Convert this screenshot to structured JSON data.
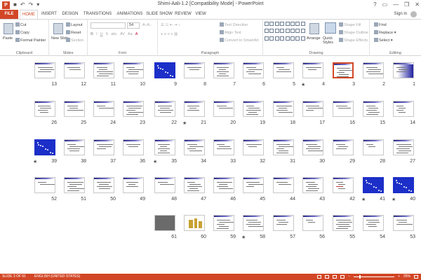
{
  "window": {
    "title": "Shimi-Aali-1.2 [Compatibility Mode] - PowerPoint",
    "app_icon": "P",
    "controls": [
      "?",
      "▭",
      "—",
      "❐",
      "✕"
    ],
    "qat": [
      "↶",
      "↷",
      "▾"
    ]
  },
  "tabs": [
    {
      "label": "FILE"
    },
    {
      "label": "HOME"
    },
    {
      "label": "INSERT"
    },
    {
      "label": "DESIGN"
    },
    {
      "label": "TRANSITIONS"
    },
    {
      "label": "ANIMATIONS"
    },
    {
      "label": "SLIDE SHOW"
    },
    {
      "label": "REVIEW"
    },
    {
      "label": "VIEW"
    }
  ],
  "signin": "Sign in",
  "ribbon": {
    "clipboard": {
      "label": "Clipboard",
      "paste": "Paste",
      "cut": "Cut",
      "copy": "Copy",
      "format_painter": "Format Painter"
    },
    "slides": {
      "label": "Slides",
      "new_slide": "New Slide",
      "layout": "Layout",
      "reset": "Reset",
      "section": "Section"
    },
    "font": {
      "label": "Font",
      "font_size": "54",
      "buttons": [
        "B",
        "I",
        "U",
        "S",
        "abc",
        "AV",
        "Aa",
        "A"
      ]
    },
    "paragraph": {
      "label": "Paragraph",
      "text_direction": "Text Direction",
      "align_text": "Align Text",
      "convert_smartart": "Convert to SmartArt"
    },
    "drawing": {
      "label": "Drawing",
      "arrange": "Arrange",
      "quick_styles": "Quick Styles",
      "shape_fill": "Shape Fill",
      "shape_outline": "Shape Outline",
      "shape_effects": "Shape Effects"
    },
    "editing": {
      "label": "Editing",
      "find": "Find",
      "replace": "Replace",
      "select": "Select"
    }
  },
  "slides": [
    {
      "n": "13"
    },
    {
      "n": "12"
    },
    {
      "n": "11"
    },
    {
      "n": "10"
    },
    {
      "n": "9"
    },
    {
      "n": "8"
    },
    {
      "n": "7"
    },
    {
      "n": "6"
    },
    {
      "n": "5"
    },
    {
      "n": "4",
      "star": true
    },
    {
      "n": "3",
      "selected": true
    },
    {
      "n": "2"
    },
    {
      "n": "1"
    },
    {
      "n": "26"
    },
    {
      "n": "25"
    },
    {
      "n": "24"
    },
    {
      "n": "23"
    },
    {
      "n": "22"
    },
    {
      "n": "21",
      "star": true
    },
    {
      "n": "20"
    },
    {
      "n": "19"
    },
    {
      "n": "18"
    },
    {
      "n": "17"
    },
    {
      "n": "16"
    },
    {
      "n": "15"
    },
    {
      "n": "14"
    },
    {
      "n": "39",
      "star": true
    },
    {
      "n": "38"
    },
    {
      "n": "37"
    },
    {
      "n": "36"
    },
    {
      "n": "35",
      "star": true
    },
    {
      "n": "34"
    },
    {
      "n": "33"
    },
    {
      "n": "32"
    },
    {
      "n": "31"
    },
    {
      "n": "30"
    },
    {
      "n": "29"
    },
    {
      "n": "28"
    },
    {
      "n": "27"
    },
    {
      "n": "52"
    },
    {
      "n": "51"
    },
    {
      "n": "50"
    },
    {
      "n": "49"
    },
    {
      "n": "48"
    },
    {
      "n": "47"
    },
    {
      "n": "46"
    },
    {
      "n": "45"
    },
    {
      "n": "44"
    },
    {
      "n": "43"
    },
    {
      "n": "42"
    },
    {
      "n": "41",
      "star": true
    },
    {
      "n": "40",
      "star": true
    },
    {
      "n": "61"
    },
    {
      "n": "60"
    },
    {
      "n": "59"
    },
    {
      "n": "58",
      "star": true
    },
    {
      "n": "57"
    },
    {
      "n": "56"
    },
    {
      "n": "55"
    },
    {
      "n": "54"
    },
    {
      "n": "53"
    }
  ],
  "status": {
    "slide_info": "SLIDE 3 OF 61",
    "language": "ENGLISH (UNITED STATES)",
    "zoom": "25%"
  },
  "colors": {
    "accent": "#d24726",
    "slide_blue": "#1c2fc8"
  }
}
